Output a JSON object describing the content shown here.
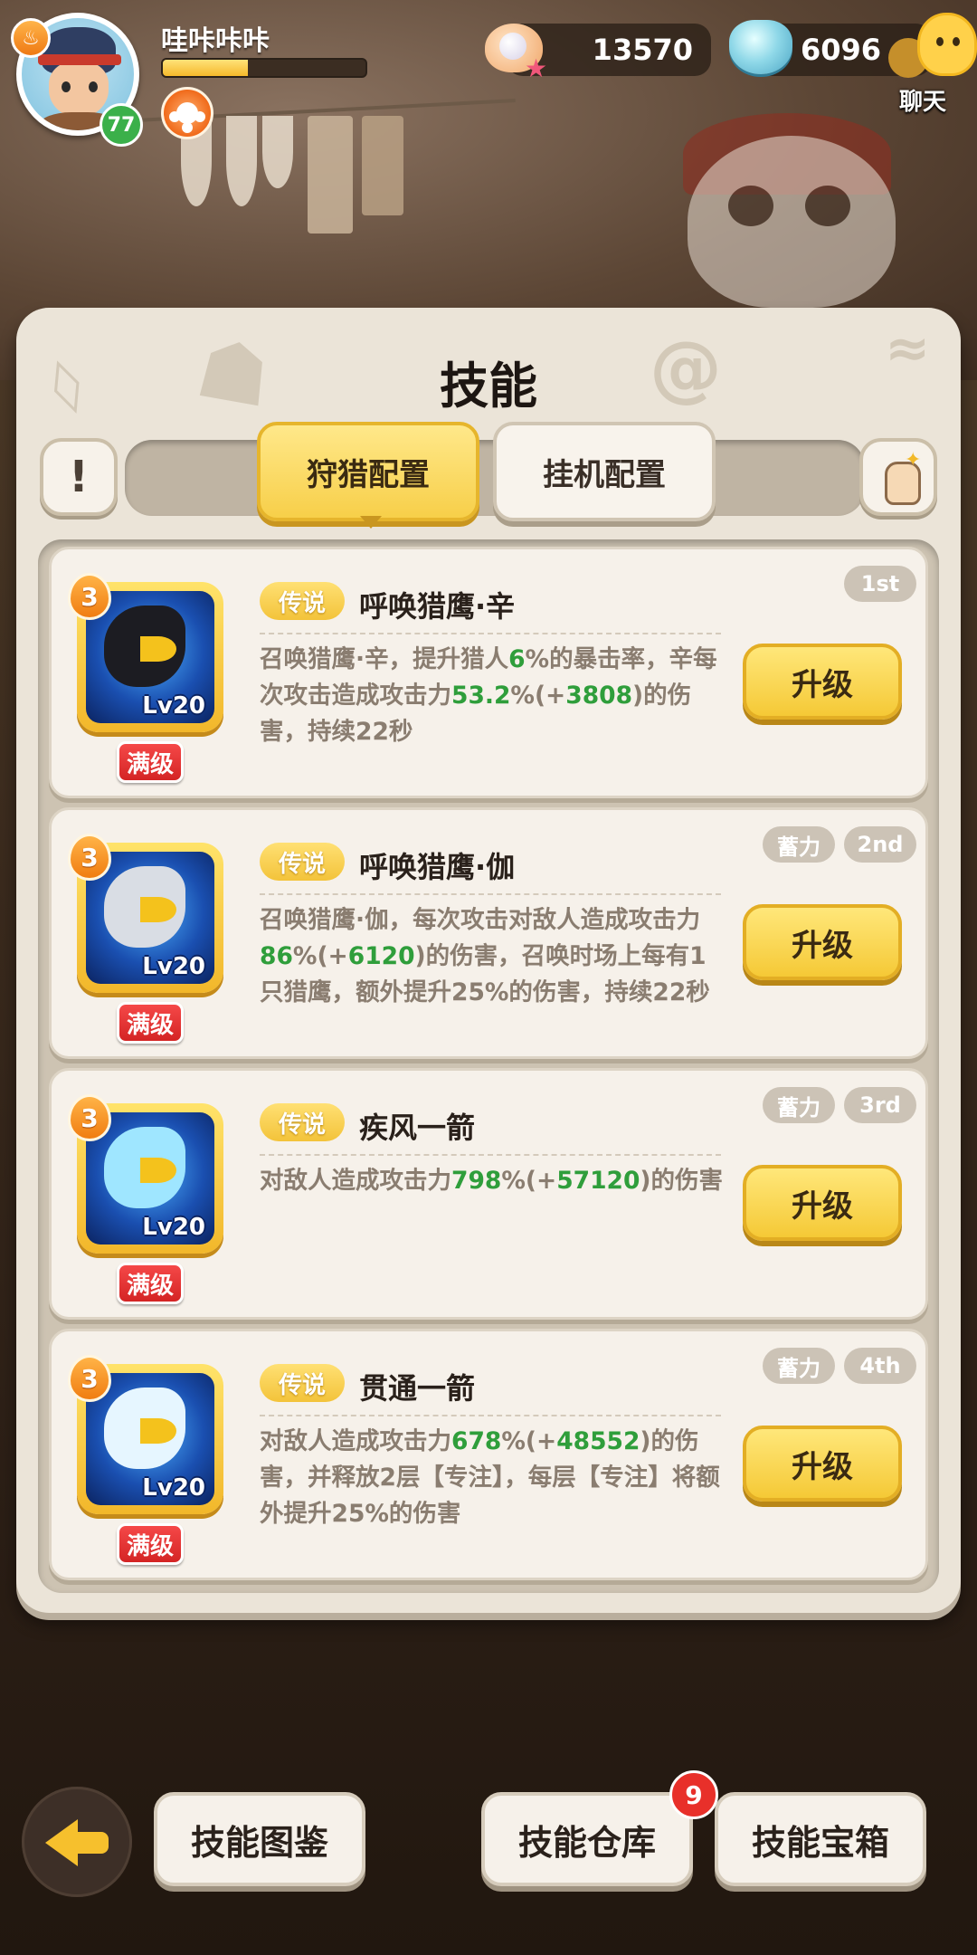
{
  "player": {
    "name": "哇咔咔咔",
    "level": "77",
    "xp_fraction": 0.42
  },
  "currencies": {
    "pearls": "13570",
    "gems": "6096"
  },
  "chat": {
    "label": "聊天"
  },
  "panel": {
    "title": "技能",
    "info_icon": "!",
    "tabs": [
      {
        "label": "狩猎配置",
        "active": true
      },
      {
        "label": "挂机配置",
        "active": false
      }
    ]
  },
  "skills": [
    {
      "stars": "3",
      "level": "Lv20",
      "max_label": "满级",
      "rarity": "传说",
      "name": "呼唤猎鹰·辛",
      "order": "1st",
      "charge": "",
      "desc_parts": [
        {
          "t": "召唤猎鹰·辛，提升猎人"
        },
        {
          "t": "6",
          "g": true
        },
        {
          "t": "%的暴击率，辛每次攻击造成攻击力"
        },
        {
          "t": "53.2",
          "g": true
        },
        {
          "t": "%(+"
        },
        {
          "t": "3808",
          "g": true
        },
        {
          "t": ")的伤害，持续22秒"
        }
      ],
      "upgrade": "升级",
      "art_color": "#1c1c22"
    },
    {
      "stars": "3",
      "level": "Lv20",
      "max_label": "满级",
      "rarity": "传说",
      "name": "呼唤猎鹰·伽",
      "order": "2nd",
      "charge": "蓄力",
      "desc_parts": [
        {
          "t": "召唤猎鹰·伽，每次攻击对敌人造成攻击力"
        },
        {
          "t": "86",
          "g": true
        },
        {
          "t": "%(+"
        },
        {
          "t": "6120",
          "g": true
        },
        {
          "t": ")的伤害，召唤时场上每有1只猎鹰，额外提升25%的伤害，持续22秒"
        }
      ],
      "upgrade": "升级",
      "art_color": "#d9dde4"
    },
    {
      "stars": "3",
      "level": "Lv20",
      "max_label": "满级",
      "rarity": "传说",
      "name": "疾风一箭",
      "order": "3rd",
      "charge": "蓄力",
      "desc_parts": [
        {
          "t": "对敌人造成攻击力"
        },
        {
          "t": "798",
          "g": true
        },
        {
          "t": "%(+"
        },
        {
          "t": "57120",
          "g": true
        },
        {
          "t": ")的伤害"
        }
      ],
      "upgrade": "升级",
      "art_color": "#9fe6ff"
    },
    {
      "stars": "3",
      "level": "Lv20",
      "max_label": "满级",
      "rarity": "传说",
      "name": "贯通一箭",
      "order": "4th",
      "charge": "蓄力",
      "desc_parts": [
        {
          "t": "对敌人造成攻击力"
        },
        {
          "t": "678",
          "g": true
        },
        {
          "t": "%(+"
        },
        {
          "t": "48552",
          "g": true
        },
        {
          "t": ")的伤害，并释放2层【专注】，每层【专注】将额外提升25%的伤害"
        }
      ],
      "upgrade": "升级",
      "art_color": "#e6f6ff"
    }
  ],
  "bottom": {
    "codex": "技能图鉴",
    "warehouse": "技能仓库",
    "warehouse_badge": "9",
    "chest": "技能宝箱"
  },
  "colors": {
    "accent_yellow": "#f5c936",
    "highlight_green": "#2f9e3b",
    "max_red": "#e02a2a"
  }
}
